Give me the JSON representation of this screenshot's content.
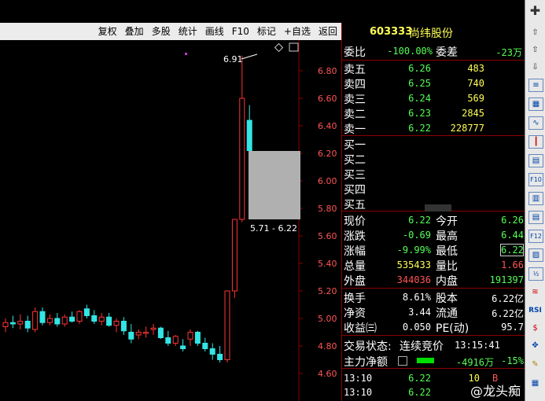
{
  "toolbar": {
    "items": [
      "复权",
      "叠加",
      "多股",
      "统计",
      "画线",
      "F10",
      "标记",
      "+自选",
      "返回"
    ]
  },
  "quote": {
    "code": "603333",
    "name": "尚纬股份",
    "webi_label": "委比",
    "webi": "-100.00%",
    "weicha_label": "委差",
    "weicha": "-23万",
    "sell": [
      {
        "label": "卖五",
        "price": "6.26",
        "vol": "483"
      },
      {
        "label": "卖四",
        "price": "6.25",
        "vol": "740"
      },
      {
        "label": "卖三",
        "price": "6.24",
        "vol": "569"
      },
      {
        "label": "卖二",
        "price": "6.23",
        "vol": "2845"
      },
      {
        "label": "卖一",
        "price": "6.22",
        "vol": "228777"
      }
    ],
    "buy": [
      {
        "label": "买一"
      },
      {
        "label": "买二"
      },
      {
        "label": "买三"
      },
      {
        "label": "买四"
      },
      {
        "label": "买五"
      }
    ],
    "stats": {
      "xianjia_label": "现价",
      "xianjia": "6.22",
      "jinkai_label": "今开",
      "jinkai": "6.26",
      "zhangdie_label": "涨跌",
      "zhangdie": "-0.69",
      "zuigao_label": "最高",
      "zuigao": "6.44",
      "zhangfu_label": "涨幅",
      "zhangfu": "-9.99%",
      "zuidi_label": "最低",
      "zuidi": "6.22",
      "zongliang_label": "总量",
      "zongliang": "535433",
      "liangbi_label": "量比",
      "liangbi": "1.66",
      "waipan_label": "外盘",
      "waipan": "344036",
      "neipan_label": "内盘",
      "neipan": "191397",
      "huanshou_label": "换手",
      "huanshou": "8.61%",
      "guben_label": "股本",
      "guben": "6.22亿",
      "jingzi_label": "净资",
      "jingzi": "3.44",
      "liutong_label": "流通",
      "liutong": "6.22亿",
      "shouyi_label": "收益㈢",
      "shouyi": "0.050",
      "pe_label": "PE(动)",
      "pe": "95.7"
    },
    "trade_status_label": "交易状态:",
    "trade_status": "连续竞价",
    "trade_time": "13:15:41",
    "main_flow_label": "主力净额",
    "main_flow": "-4916万",
    "main_flow_pct": "-15%",
    "ticks": [
      {
        "time": "13:10",
        "price": "6.22",
        "vol": "10",
        "side": "B"
      },
      {
        "time": "13:10",
        "price": "6.22",
        "vol": "",
        "side": ""
      }
    ]
  },
  "chart_data": {
    "type": "candlestick",
    "y_ticks": [
      "6.80",
      "6.60",
      "6.40",
      "6.20",
      "6.00",
      "5.80",
      "5.60",
      "5.40",
      "5.20",
      "5.00",
      "4.80",
      "4.60"
    ],
    "annotations": {
      "high_marker": "6.91",
      "range_box": "5.71 - 6.22"
    },
    "ylim": [
      4.6,
      6.9
    ]
  },
  "watermark": "@龙头痴",
  "colors": {
    "up": "#ff3333",
    "down": "#33e5e5",
    "bg": "#000000",
    "grid": "#8b0000"
  }
}
